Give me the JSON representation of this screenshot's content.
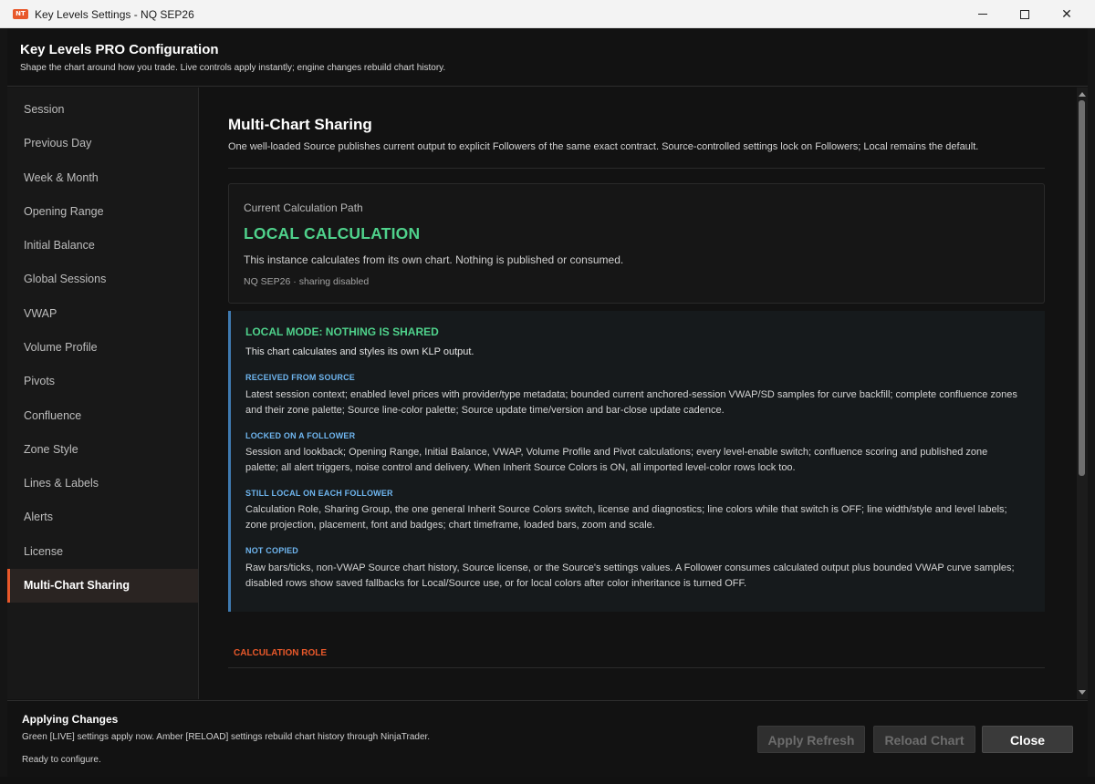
{
  "window": {
    "logo_text": "NT",
    "title": "Key Levels Settings - NQ SEP26",
    "minimize_label": "",
    "maximize_label": "",
    "close_label": "✕"
  },
  "header": {
    "title": "Key Levels PRO Configuration",
    "subtitle": "Shape the chart around how you trade. Live controls apply instantly; engine changes rebuild chart history."
  },
  "sidebar": {
    "items": [
      {
        "label": "Session"
      },
      {
        "label": "Previous Day"
      },
      {
        "label": "Week & Month"
      },
      {
        "label": "Opening Range"
      },
      {
        "label": "Initial Balance"
      },
      {
        "label": "Global Sessions"
      },
      {
        "label": "VWAP"
      },
      {
        "label": "Volume Profile"
      },
      {
        "label": "Pivots"
      },
      {
        "label": "Confluence"
      },
      {
        "label": "Zone Style"
      },
      {
        "label": "Lines & Labels"
      },
      {
        "label": "Alerts"
      },
      {
        "label": "License"
      },
      {
        "label": "Multi-Chart Sharing"
      }
    ],
    "active_index": 14
  },
  "main": {
    "title": "Multi-Chart Sharing",
    "description": "One well-loaded Source publishes current output to explicit Followers of the same exact contract. Source-controlled settings lock on Followers; Local remains the default.",
    "path_card": {
      "label": "Current Calculation Path",
      "value": "LOCAL CALCULATION",
      "description": "This instance calculates from its own chart. Nothing is published or consumed.",
      "meta": "NQ SEP26 · sharing disabled"
    },
    "info": {
      "title": "LOCAL MODE: NOTHING IS SHARED",
      "lead": "This chart calculates and styles its own KLP output.",
      "sections": [
        {
          "heading": "RECEIVED FROM SOURCE",
          "body": "Latest session context; enabled level prices with provider/type metadata; bounded current anchored-session VWAP/SD samples for curve backfill; complete confluence zones and their zone palette; Source line-color palette; Source update time/version and bar-close update cadence."
        },
        {
          "heading": "LOCKED ON A FOLLOWER",
          "body": "Session and lookback; Opening Range, Initial Balance, VWAP, Volume Profile and Pivot calculations; every level-enable switch; confluence scoring and published zone palette; all alert triggers, noise control and delivery. When Inherit Source Colors is ON, all imported level-color rows lock too."
        },
        {
          "heading": "STILL LOCAL ON EACH FOLLOWER",
          "body": "Calculation Role, Sharing Group, the one general Inherit Source Colors switch, license and diagnostics; line colors while that switch is OFF; line width/style and level labels; zone projection, placement, font and badges; chart timeframe, loaded bars, zoom and scale."
        },
        {
          "heading": "NOT COPIED",
          "body": "Raw bars/ticks, non-VWAP Source chart history, Source license, or the Source's settings values. A Follower consumes calculated output plus bounded VWAP curve samples; disabled rows show saved fallbacks for Local/Source use, or for local colors after color inheritance is turned OFF."
        }
      ]
    },
    "next_section": "CALCULATION ROLE"
  },
  "footer": {
    "title": "Applying Changes",
    "description": "Green [LIVE] settings apply now. Amber [RELOAD] settings rebuild chart history through NinjaTrader.",
    "status": "Ready to configure.",
    "apply_label": "Apply Refresh",
    "reload_label": "Reload Chart",
    "close_label": "Close"
  },
  "colors": {
    "accent": "#e8582a",
    "local_green": "#4fd18b",
    "info_blue": "#6fb6f0",
    "background": "#121212"
  }
}
